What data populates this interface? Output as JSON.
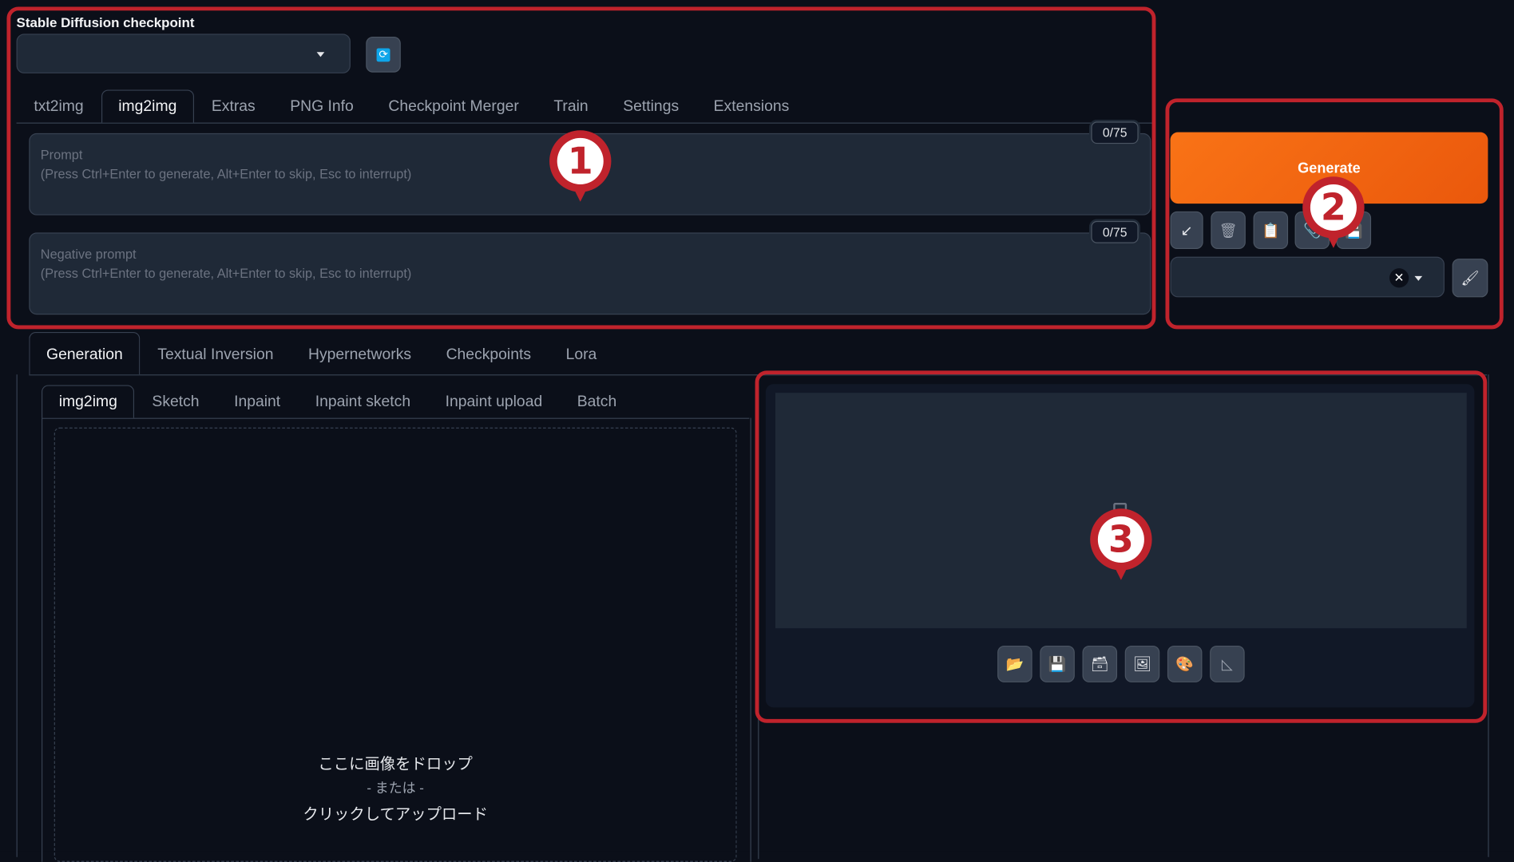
{
  "checkpoint": {
    "label": "Stable Diffusion checkpoint",
    "value": "",
    "refresh_icon": "refresh-icon"
  },
  "main_tabs": [
    {
      "label": "txt2img"
    },
    {
      "label": "img2img",
      "selected": true
    },
    {
      "label": "Extras"
    },
    {
      "label": "PNG Info"
    },
    {
      "label": "Checkpoint Merger"
    },
    {
      "label": "Train"
    },
    {
      "label": "Settings"
    },
    {
      "label": "Extensions"
    }
  ],
  "prompt": {
    "placeholder": "Prompt\n(Press Ctrl+Enter to generate, Alt+Enter to skip, Esc to interrupt)",
    "line1": "Prompt",
    "line2": "(Press Ctrl+Enter to generate, Alt+Enter to skip, Esc to interrupt)",
    "token_count": "0/75"
  },
  "negative_prompt": {
    "line1": "Negative prompt",
    "line2": "(Press Ctrl+Enter to generate, Alt+Enter to skip, Esc to interrupt)",
    "token_count": "0/75"
  },
  "generate": {
    "label": "Generate",
    "color": "#f97316"
  },
  "tool_buttons": [
    "arrow-down-left-icon",
    "trash-icon",
    "clipboard-icon",
    "paperclip-icon",
    "style-icon"
  ],
  "styles": {
    "value": ""
  },
  "sub_tabs": [
    {
      "label": "Generation",
      "selected": true
    },
    {
      "label": "Textual Inversion"
    },
    {
      "label": "Hypernetworks"
    },
    {
      "label": "Checkpoints"
    },
    {
      "label": "Lora"
    }
  ],
  "input_tabs": [
    {
      "label": "img2img",
      "selected": true
    },
    {
      "label": "Sketch"
    },
    {
      "label": "Inpaint"
    },
    {
      "label": "Inpaint sketch"
    },
    {
      "label": "Inpaint upload"
    },
    {
      "label": "Batch"
    }
  ],
  "upload": {
    "line1": "ここに画像をドロップ",
    "line2": "- または -",
    "line3": "クリックしてアップロード"
  },
  "output_buttons": [
    "folder-icon",
    "save-icon",
    "zip-icon",
    "send-to-img2img-icon",
    "send-to-inpaint-icon",
    "send-to-extras-icon"
  ],
  "annotations": {
    "one": "1",
    "two": "2",
    "three": "3",
    "color": "#c0232c"
  }
}
